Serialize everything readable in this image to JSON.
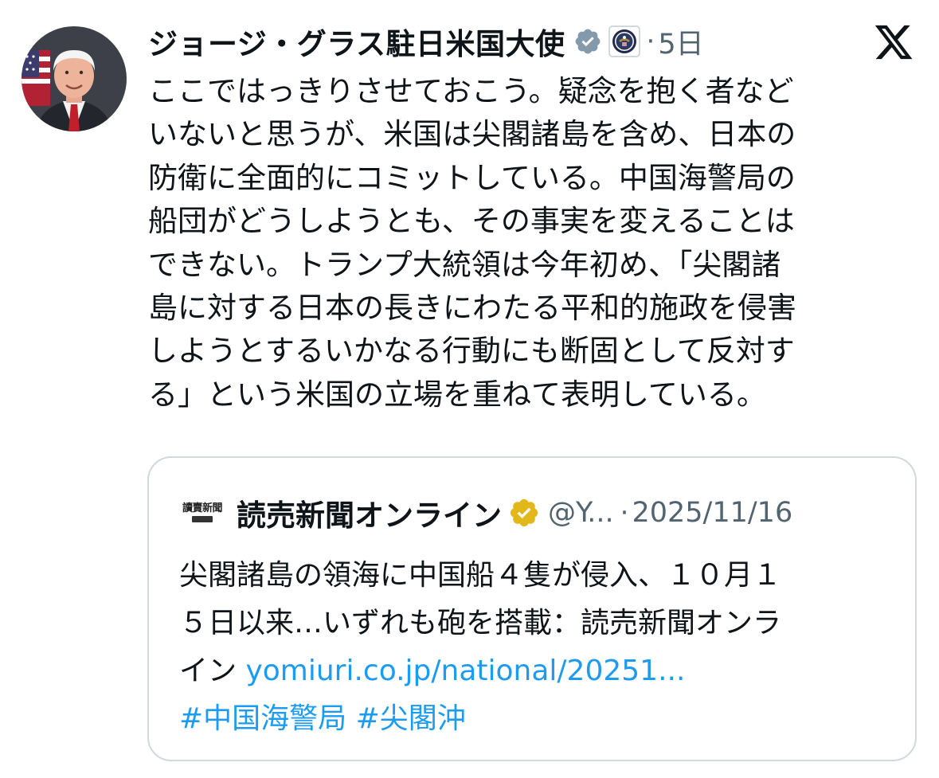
{
  "tweet": {
    "author": {
      "display_name": "ジョージ・グラス駐日米国大使",
      "verified_badge": "gray-check-icon",
      "affiliate_badge": "us-state-department-seal-icon",
      "avatar": "profile-photo"
    },
    "separator": "·",
    "time_ago": "5日",
    "platform_logo": "x-logo",
    "text_lines": [
      "ここではっきりさせておこう。疑念を抱く者など",
      "いないと思うが、米国は尖閣諸島を含め、日本の",
      "防衛に全面的にコミットしている。中国海警局の",
      "船団がどうしようとも、その事実を変えることは",
      "できない。トランプ大統領は今年初め、「尖閣諸",
      "島に対する日本の長きにわたる平和的施政を侵害",
      "しようとするいかなる行動にも断固として反対す",
      "る」という米国の立場を重ねて表明している。"
    ]
  },
  "quote": {
    "logo_text": "讀賣新聞",
    "name": "読売新聞オンライン",
    "verified_badge": "gold-check-icon",
    "handle": "@Y...",
    "separator": "·",
    "date": "2025/11/16",
    "text_lines": [
      "尖閣諸島の領海に中国船４隻が侵入、１０月１",
      "５日以来…いずれも砲を搭載：読売新聞オンラ"
    ],
    "line3_text": "イン ",
    "link": "yomiuri.co.jp/national/20251...",
    "hashtag1": "#中国海警局",
    "hashtag2": "#尖閣沖"
  },
  "colors": {
    "text": "#0f1419",
    "secondary": "#536471",
    "link": "#1d9bf0",
    "border": "#cfd9de",
    "gray_badge": "#829aab",
    "gold_badge": "#e2b719"
  }
}
